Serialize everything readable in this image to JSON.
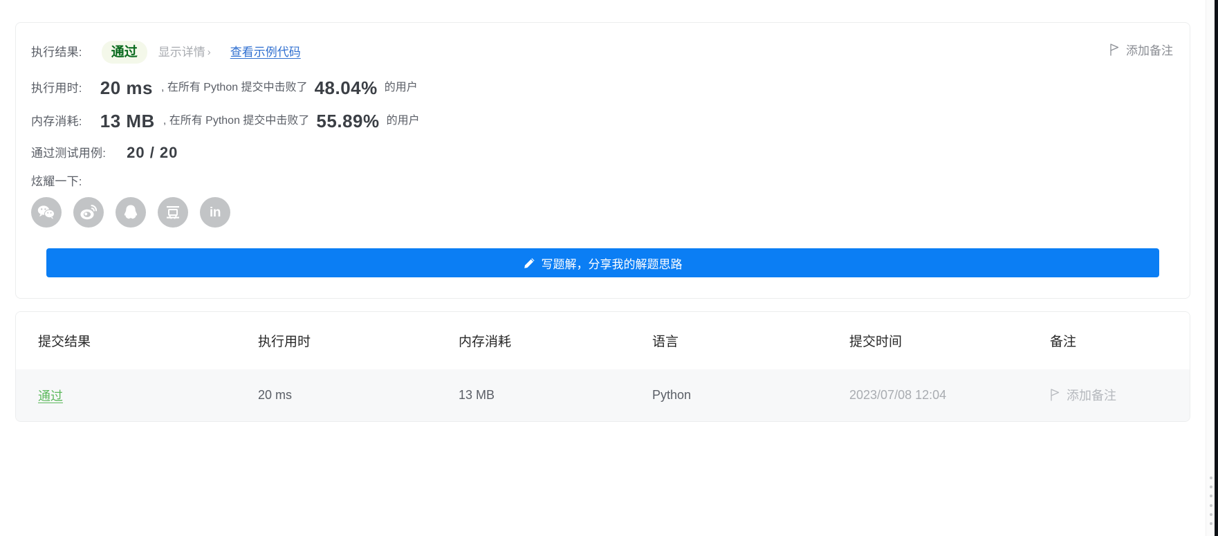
{
  "result_card": {
    "result_label": "执行结果:",
    "result_status": "通过",
    "detail_toggle": "显示详情",
    "detail_chevron": "›",
    "sample_code_link": "查看示例代码",
    "add_note_top": "添加备注",
    "runtime_label": "执行用时:",
    "runtime_value": "20 ms",
    "runtime_tail_prefix": ", 在所有 Python 提交中击败了",
    "runtime_percentile": "48.04%",
    "runtime_tail_suffix": "的用户",
    "memory_label": "内存消耗:",
    "memory_value": "13 MB",
    "memory_tail_prefix": ", 在所有 Python 提交中击败了",
    "memory_percentile": "55.89%",
    "memory_tail_suffix": "的用户",
    "cases_label": "通过测试用例:",
    "cases_value": "20 / 20",
    "brag_label": "炫耀一下:",
    "social_icons": [
      {
        "name": "wechat-icon",
        "title": "微信"
      },
      {
        "name": "weibo-icon",
        "title": "微博"
      },
      {
        "name": "qq-icon",
        "title": "QQ"
      },
      {
        "name": "douban-icon",
        "title": "豆瓣"
      },
      {
        "name": "linkedin-icon",
        "title": "LinkedIn",
        "text": "in"
      }
    ],
    "cta_label": "写题解，分享我的解题思路",
    "cta_color": "#0b7ef4"
  },
  "submissions_table": {
    "headers": [
      "提交结果",
      "执行用时",
      "内存消耗",
      "语言",
      "提交时间",
      "备注"
    ],
    "rows": [
      {
        "status": "通过",
        "status_color": "#5cb85c",
        "runtime": "20 ms",
        "memory": "13 MB",
        "language": "Python",
        "submit_time": "2023/07/08 12:04",
        "note": "添加备注"
      }
    ]
  }
}
